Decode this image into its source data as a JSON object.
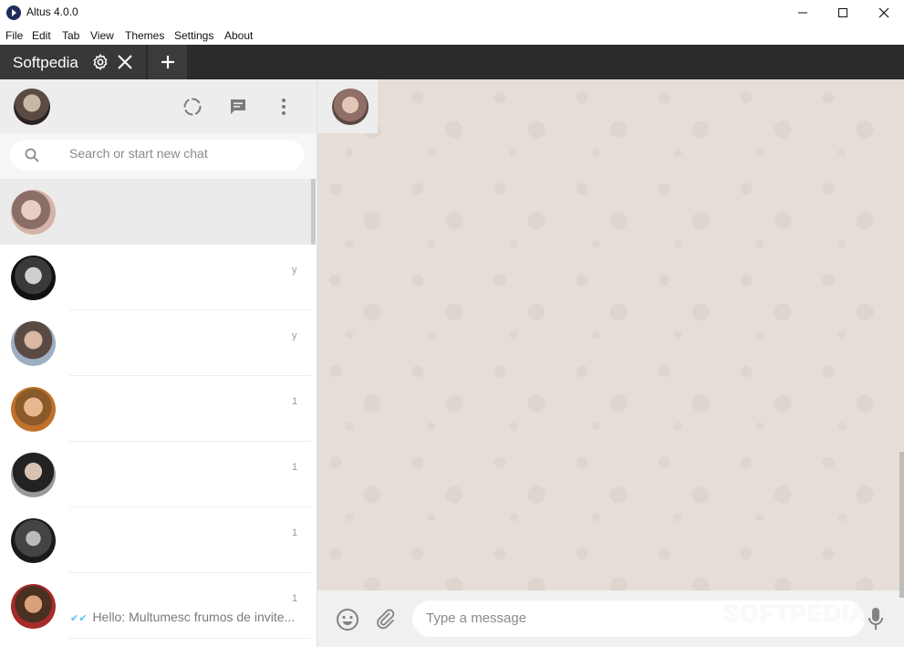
{
  "window": {
    "title": "Altus 4.0.0"
  },
  "menu": [
    "File",
    "Edit",
    "Tab",
    "View",
    "Themes",
    "Settings",
    "About"
  ],
  "tab": {
    "label": "Softpedia"
  },
  "search": {
    "placeholder": "Search or start new chat"
  },
  "chats": [
    {
      "time": "",
      "preview": "",
      "selected": true
    },
    {
      "time": "y",
      "preview": ""
    },
    {
      "time": "y",
      "preview": ""
    },
    {
      "time": "1",
      "preview": ""
    },
    {
      "time": "1",
      "preview": ""
    },
    {
      "time": "1",
      "preview": ""
    },
    {
      "time": "1",
      "preview": "Hello: Multumesc frumos de invite..."
    }
  ],
  "composer": {
    "placeholder": "Type a message"
  },
  "watermark": "SOFTPEDIA",
  "colors": {
    "tabbar": "#2b2b2b",
    "panel_header": "#ededed",
    "chat_bg": "#e5ddd5",
    "composer_bg": "#f0f0f0"
  },
  "icons": [
    "app-icon",
    "minimize-icon",
    "maximize-icon",
    "close-icon",
    "gear-icon",
    "tab-close-icon",
    "add-tab-icon",
    "status-icon",
    "new-chat-icon",
    "menu-icon",
    "search-icon",
    "emoji-icon",
    "attach-icon",
    "mic-icon"
  ]
}
